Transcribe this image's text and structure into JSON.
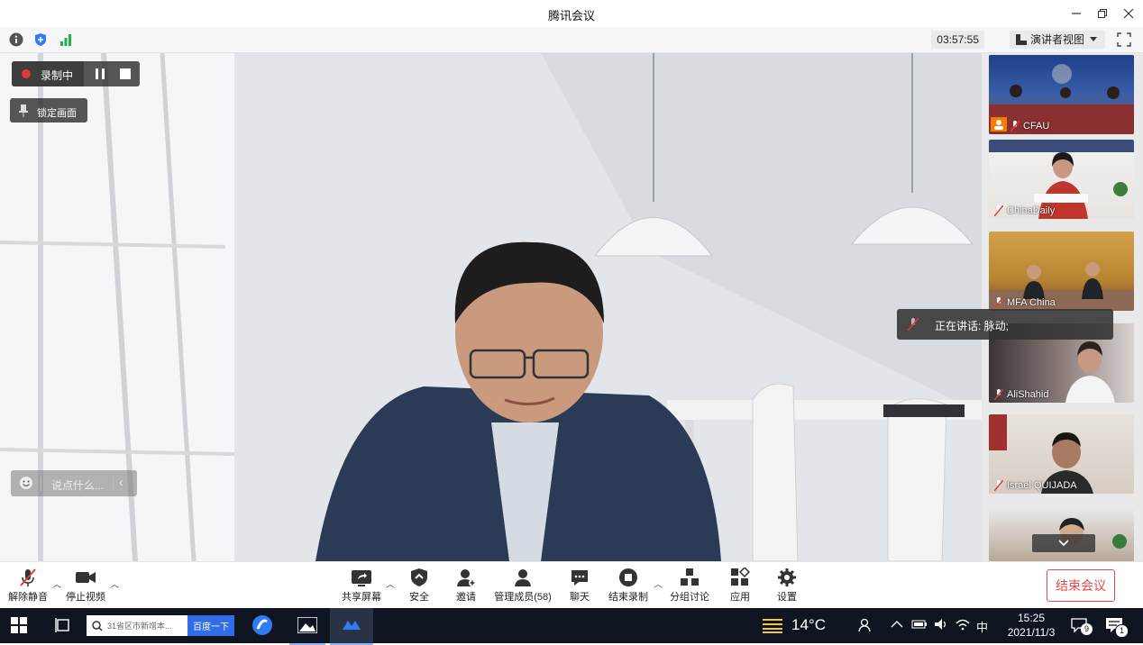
{
  "window": {
    "title": "腾讯会议"
  },
  "toolbar": {
    "timer": "03:57:55",
    "view_label": "演讲者视图"
  },
  "overlay": {
    "recording_label": "录制中",
    "lock_screen_label": "锁定画面",
    "chat_placeholder": "说点什么...",
    "speaking_label": "正在讲话: 脉动;"
  },
  "participants": [
    {
      "name": "CFAU"
    },
    {
      "name": "ChinaDaily"
    },
    {
      "name": "MFA China"
    },
    {
      "name": "AliShahid"
    },
    {
      "name": "Israel QUIJADA"
    }
  ],
  "controls": {
    "unmute": "解除静音",
    "stop_video": "停止视频",
    "share_screen": "共享屏幕",
    "security": "安全",
    "invite": "邀请",
    "members": "管理成员(58)",
    "chat": "聊天",
    "end_recording": "结束录制",
    "breakout": "分组讨论",
    "apps": "应用",
    "settings": "设置",
    "end_meeting": "结束会议"
  },
  "taskbar": {
    "search_placeholder": "31省区市新增本...",
    "search_button": "百度一下",
    "weather": "14°C",
    "ime": "中",
    "time": "15:25",
    "date": "2021/11/3",
    "notifications": "9",
    "action_center_badge": "1"
  },
  "colors": {
    "accent_blue": "#2f7cf6",
    "record_red": "#e53935",
    "end_red": "#e5484d",
    "signal_green": "#1fb24a"
  }
}
